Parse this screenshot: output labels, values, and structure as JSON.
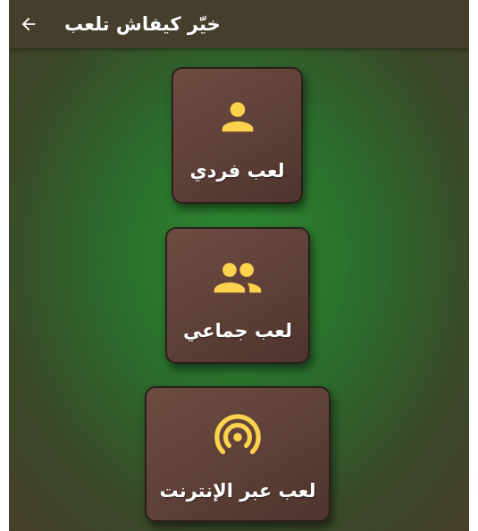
{
  "appbar": {
    "title": "خيّر كيفاش تلعب",
    "back_icon": "arrow-back-icon"
  },
  "modes": [
    {
      "label": "لعب فردي",
      "icon": "person-icon"
    },
    {
      "label": "لعب جماعي",
      "icon": "group-icon"
    },
    {
      "label": "لعب عبر الإنترنت",
      "icon": "online-signal-icon"
    }
  ],
  "colors": {
    "appbar": "#463e2d",
    "background_center": "#2f8a32",
    "card": "#5d4037",
    "icon": "#fdd24e",
    "text": "#ffffff"
  }
}
